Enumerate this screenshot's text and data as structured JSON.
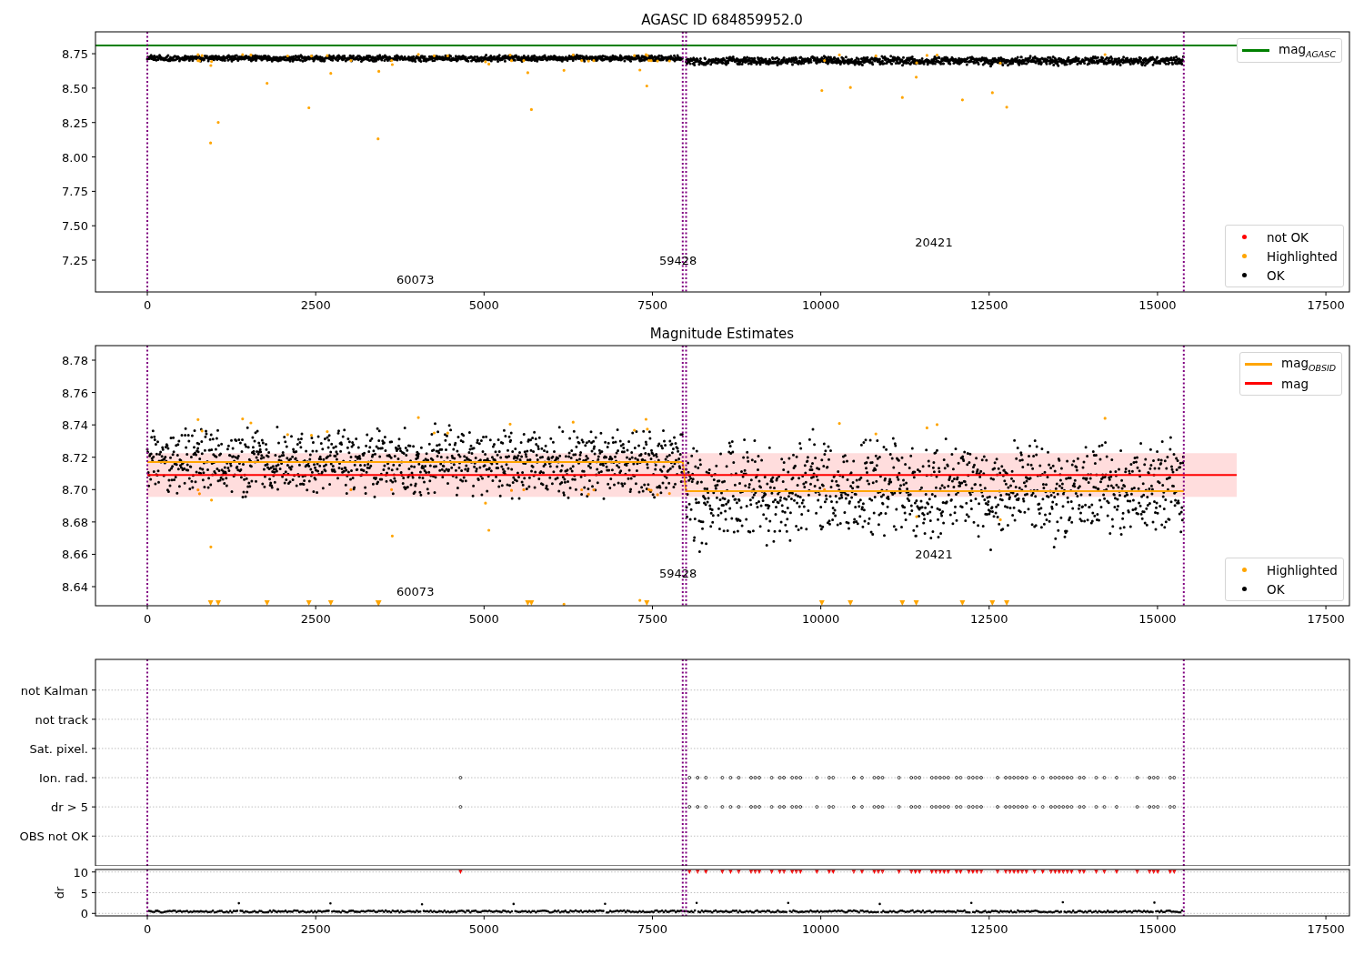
{
  "panels": [
    {
      "kind": "mag",
      "chart_data": {
        "type": "scatter",
        "title": "AGASC ID 684859952.0",
        "xlim": [
          -770,
          17850
        ],
        "ylim": [
          7.019,
          8.909
        ],
        "xticks": [
          0,
          2500,
          5000,
          7500,
          10000,
          12500,
          15000,
          17500
        ],
        "yticks": [
          {
            "value": 7.25,
            "label": "7.25"
          },
          {
            "value": 7.5,
            "label": "7.50"
          },
          {
            "value": 7.75,
            "label": "7.75"
          },
          {
            "value": 8.0,
            "label": "8.00"
          },
          {
            "value": 8.25,
            "label": "8.25"
          },
          {
            "value": 8.5,
            "label": "8.50"
          },
          {
            "value": 8.75,
            "label": "8.75"
          }
        ],
        "series": [
          {
            "name": "mag$_{AGASC}$",
            "type": "line",
            "color": "#008000",
            "x": [
              -770,
              16176
            ],
            "values": [
              8.81,
              8.81
            ]
          }
        ],
        "ref_lines": [
          {
            "axis": "x",
            "value": 0,
            "color": "#800080"
          },
          {
            "axis": "x",
            "value": 7950,
            "color": "#800080"
          },
          {
            "axis": "x",
            "value": 8000,
            "color": "#800080"
          },
          {
            "axis": "x",
            "value": 15390,
            "color": "#800080"
          }
        ],
        "annotations": [
          "60073",
          "59428",
          "20421"
        ]
      },
      "point_classes": [
        {
          "label": "not OK",
          "color": "#ff0000"
        },
        {
          "label": "Highlighted",
          "color": "#ffa500"
        },
        {
          "label": "OK",
          "color": "#000000"
        }
      ]
    },
    {
      "kind": "mag",
      "chart_data": {
        "type": "scatter",
        "title": "Magnitude Estimates",
        "xlim": [
          -770,
          17850
        ],
        "ylim": [
          8.6282,
          8.789
        ],
        "xticks": [
          0,
          2500,
          5000,
          7500,
          10000,
          12500,
          15000,
          17500
        ],
        "yticks": [
          {
            "value": 8.64,
            "label": "8.64"
          },
          {
            "value": 8.66,
            "label": "8.66"
          },
          {
            "value": 8.68,
            "label": "8.68"
          },
          {
            "value": 8.7,
            "label": "8.70"
          },
          {
            "value": 8.72,
            "label": "8.72"
          },
          {
            "value": 8.74,
            "label": "8.74"
          },
          {
            "value": 8.76,
            "label": "8.76"
          },
          {
            "value": 8.78,
            "label": "8.78"
          }
        ],
        "series": [
          {
            "name": "mag$_{OBSID}$",
            "type": "line",
            "color": "#ffa500",
            "x": [
              0,
              7950,
              8000,
              15390
            ],
            "values": [
              8.717,
              8.717,
              8.699,
              8.699
            ]
          },
          {
            "name": "mag",
            "type": "line",
            "color": "#ff0000",
            "x": [
              0,
              16176
            ],
            "values": [
              8.709,
              8.709
            ]
          }
        ],
        "bands": [
          {
            "axis": "y",
            "from": 8.6955,
            "to": 8.7225,
            "color": "#ffdddd"
          }
        ],
        "ref_lines": [
          {
            "axis": "x",
            "value": 0,
            "color": "#800080"
          },
          {
            "axis": "x",
            "value": 7950,
            "color": "#800080"
          },
          {
            "axis": "x",
            "value": 8000,
            "color": "#800080"
          },
          {
            "axis": "x",
            "value": 15390,
            "color": "#800080"
          }
        ],
        "annotations": [
          "60073",
          "59428",
          "20421"
        ]
      },
      "point_classes": [
        {
          "label": "Highlighted",
          "color": "#ffa500"
        },
        {
          "label": "OK",
          "color": "#000000"
        }
      ]
    },
    {
      "kind": "flags",
      "chart_data": {
        "type": "scatter",
        "orientation": "horizontal",
        "grid": true,
        "xlim": [
          -770,
          17850
        ],
        "categories": [
          "not Kalman",
          "not track",
          "Sat. pixel.",
          "Ion. rad.",
          "dr > 5",
          "OBS not OK"
        ],
        "ref_lines": [
          {
            "axis": "x",
            "value": 0,
            "color": "#800080"
          },
          {
            "axis": "x",
            "value": 7950,
            "color": "#800080"
          },
          {
            "axis": "x",
            "value": 8000,
            "color": "#800080"
          },
          {
            "axis": "x",
            "value": 15390,
            "color": "#800080"
          }
        ]
      }
    },
    {
      "kind": "dr",
      "chart_data": {
        "type": "scatter",
        "grid": true,
        "ylabel": "dr",
        "xlim": [
          -770,
          17850
        ],
        "ylim": [
          -0.6,
          10.6
        ],
        "xticks": [
          0,
          2500,
          5000,
          7500,
          10000,
          12500,
          15000,
          17500
        ],
        "yticks": [
          0,
          5,
          10
        ],
        "ref_lines": [
          {
            "axis": "x",
            "value": 0,
            "color": "#800080"
          },
          {
            "axis": "x",
            "value": 7950,
            "color": "#800080"
          },
          {
            "axis": "x",
            "value": 8000,
            "color": "#800080"
          },
          {
            "axis": "x",
            "value": 15390,
            "color": "#800080"
          }
        ]
      }
    }
  ]
}
